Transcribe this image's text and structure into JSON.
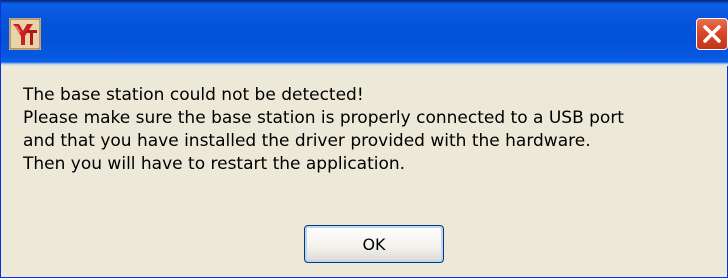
{
  "window": {
    "title": "",
    "app_icon": "app-logo-icon",
    "close_icon": "close-icon"
  },
  "dialog": {
    "message_lines": [
      "The base station could not be detected!",
      "Please make sure the base station is properly connected to a USB port",
      "and that you have installed the driver provided with the hardware.",
      "Then you will have to restart the application."
    ],
    "ok_label": "OK"
  },
  "colors": {
    "titlebar": "#0553d8",
    "close_button": "#d9462a",
    "dialog_background": "#ece9d8",
    "button_border": "#003c74"
  }
}
